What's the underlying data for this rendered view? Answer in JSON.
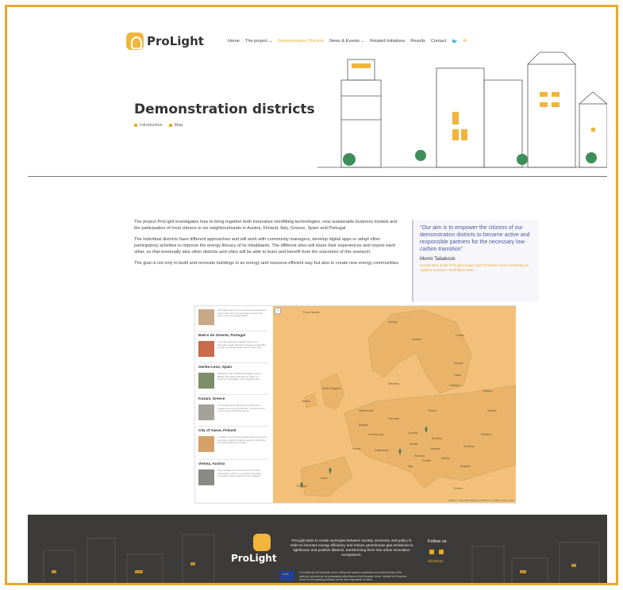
{
  "brand": {
    "name": "ProLight",
    "accent": "#e8a92b",
    "footer_bg": "#3c3b3a"
  },
  "nav": {
    "items": [
      {
        "label": "Home"
      },
      {
        "label": "The project  ⌄"
      },
      {
        "label": "Demonstration Districts"
      },
      {
        "label": "News & Events  ⌄"
      },
      {
        "label": "Related Initiatives"
      },
      {
        "label": "Results"
      },
      {
        "label": "Contact"
      }
    ],
    "active": "Demonstration Districts",
    "social_icons": [
      "twitter-icon",
      "linkedin-icon"
    ]
  },
  "hero": {
    "title": "Demonstration districts",
    "subnav": [
      "Introduction",
      "Map"
    ]
  },
  "intro": {
    "paragraphs": [
      "The project ProLight investigates how to bring together both innovative retrofitting technologies, new sustainable business models and the participation of local citizens in six neighbourhoods in Austria, Finland, Italy, Greece, Spain and Portugal.",
      "The individual districts have different approaches and will work with community managers, develop digital apps or adopt other participatory activities to improve the energy literacy of its inhabitants. The different sites will share their experiences and inspire each other, so that eventually also other districts and cities will be able to learn and benefit from the outcomes of this research.",
      "The goal is not only to build and renovate buildings in an energy and resource-efficient way but also to create new energy communities."
    ]
  },
  "quote": {
    "text": "\"Our aim is to empower the citizens of our demonstration districts to become active and responsible partners for the necessary low-carbon transition\"",
    "author": "Momir Tabakovic",
    "role": "Coordinator of the ProLight project and Professor at the University of Applied Sciences Technikum Wien"
  },
  "map_sites": [
    {
      "name": "",
      "desc": "The Italian demo site is a housing cooperative community aimed at renovation works and with a focus on sustainability."
    },
    {
      "name": "Bairro do Oriente, Portugal",
      "desc": "In the Portuguese neighbourhood, the ProLight project will work to build a renewable energy community that is led in a fair way."
    },
    {
      "name": "Geriko-Leno, Spain",
      "desc": "Situated in the UNESCO heritage town of Bilbao, the district will work to foster co-housing, renewables and engaging with..."
    },
    {
      "name": "Kozani, Greece",
      "desc": "The Greek demo site aims to retrofit and modernize energy production, and will set up a community of energy actors..."
    },
    {
      "name": "City of Vaasa, Finland",
      "desc": "In Vaasa, the ProLight project will improve and renovate a district heating network, and foster an energy-efficient housing..."
    },
    {
      "name": "Vienna, Austria",
      "desc": "The Austrian demo site will work in close cooperation with the university to develop innovative energy solutions for residents..."
    }
  ],
  "map": {
    "zoom_label": "−",
    "attribution": "Leaflet | © OpenStreetMap contributors © CARTO, Tiles © Esri",
    "labels": [
      "Faroe Islands",
      "Norway",
      "Sweden",
      "Finland",
      "Estonia",
      "Latvia",
      "Lithuania",
      "Denmark",
      "United Kingdom",
      "Ireland",
      "Netherlands",
      "Belgium",
      "Germany",
      "Poland",
      "Czechia",
      "Slovakia",
      "Austria",
      "Hungary",
      "Romania",
      "Moldova",
      "Ukraine",
      "Belarus",
      "France",
      "Switzerland",
      "Italy",
      "Slovenia",
      "Croatia",
      "Serbia",
      "Bulgaria",
      "Spain",
      "Portugal",
      "Greece",
      "Luxembourg"
    ]
  },
  "footer": {
    "brand": "ProLight",
    "text": "ProLight aims to create synergies between society, economy, and policy in order to increase energy efficiency and reduce greenhouse gas emissions in lighthouse and positive districts, transforming them into urban innovation ecosystems.",
    "follow_label": "Follow us",
    "link_label": "Disclaimer",
    "eu_text": "Co-funded by the European Union. Views and opinions expressed are however those of the author(s) only and do not necessarily reflect those of the European Union. Neither the European Union nor the granting authority can be held responsible for them."
  }
}
